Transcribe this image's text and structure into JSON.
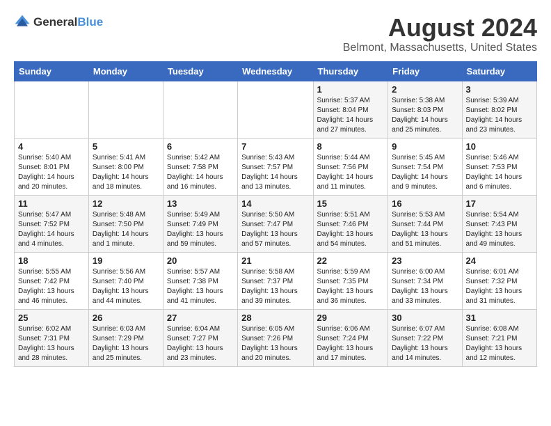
{
  "header": {
    "logo_general": "General",
    "logo_blue": "Blue",
    "month_year": "August 2024",
    "location": "Belmont, Massachusetts, United States"
  },
  "calendar": {
    "days_of_week": [
      "Sunday",
      "Monday",
      "Tuesday",
      "Wednesday",
      "Thursday",
      "Friday",
      "Saturday"
    ],
    "weeks": [
      [
        {
          "day": "",
          "info": ""
        },
        {
          "day": "",
          "info": ""
        },
        {
          "day": "",
          "info": ""
        },
        {
          "day": "",
          "info": ""
        },
        {
          "day": "1",
          "info": "Sunrise: 5:37 AM\nSunset: 8:04 PM\nDaylight: 14 hours\nand 27 minutes."
        },
        {
          "day": "2",
          "info": "Sunrise: 5:38 AM\nSunset: 8:03 PM\nDaylight: 14 hours\nand 25 minutes."
        },
        {
          "day": "3",
          "info": "Sunrise: 5:39 AM\nSunset: 8:02 PM\nDaylight: 14 hours\nand 23 minutes."
        }
      ],
      [
        {
          "day": "4",
          "info": "Sunrise: 5:40 AM\nSunset: 8:01 PM\nDaylight: 14 hours\nand 20 minutes."
        },
        {
          "day": "5",
          "info": "Sunrise: 5:41 AM\nSunset: 8:00 PM\nDaylight: 14 hours\nand 18 minutes."
        },
        {
          "day": "6",
          "info": "Sunrise: 5:42 AM\nSunset: 7:58 PM\nDaylight: 14 hours\nand 16 minutes."
        },
        {
          "day": "7",
          "info": "Sunrise: 5:43 AM\nSunset: 7:57 PM\nDaylight: 14 hours\nand 13 minutes."
        },
        {
          "day": "8",
          "info": "Sunrise: 5:44 AM\nSunset: 7:56 PM\nDaylight: 14 hours\nand 11 minutes."
        },
        {
          "day": "9",
          "info": "Sunrise: 5:45 AM\nSunset: 7:54 PM\nDaylight: 14 hours\nand 9 minutes."
        },
        {
          "day": "10",
          "info": "Sunrise: 5:46 AM\nSunset: 7:53 PM\nDaylight: 14 hours\nand 6 minutes."
        }
      ],
      [
        {
          "day": "11",
          "info": "Sunrise: 5:47 AM\nSunset: 7:52 PM\nDaylight: 14 hours\nand 4 minutes."
        },
        {
          "day": "12",
          "info": "Sunrise: 5:48 AM\nSunset: 7:50 PM\nDaylight: 14 hours\nand 1 minute."
        },
        {
          "day": "13",
          "info": "Sunrise: 5:49 AM\nSunset: 7:49 PM\nDaylight: 13 hours\nand 59 minutes."
        },
        {
          "day": "14",
          "info": "Sunrise: 5:50 AM\nSunset: 7:47 PM\nDaylight: 13 hours\nand 57 minutes."
        },
        {
          "day": "15",
          "info": "Sunrise: 5:51 AM\nSunset: 7:46 PM\nDaylight: 13 hours\nand 54 minutes."
        },
        {
          "day": "16",
          "info": "Sunrise: 5:53 AM\nSunset: 7:44 PM\nDaylight: 13 hours\nand 51 minutes."
        },
        {
          "day": "17",
          "info": "Sunrise: 5:54 AM\nSunset: 7:43 PM\nDaylight: 13 hours\nand 49 minutes."
        }
      ],
      [
        {
          "day": "18",
          "info": "Sunrise: 5:55 AM\nSunset: 7:42 PM\nDaylight: 13 hours\nand 46 minutes."
        },
        {
          "day": "19",
          "info": "Sunrise: 5:56 AM\nSunset: 7:40 PM\nDaylight: 13 hours\nand 44 minutes."
        },
        {
          "day": "20",
          "info": "Sunrise: 5:57 AM\nSunset: 7:38 PM\nDaylight: 13 hours\nand 41 minutes."
        },
        {
          "day": "21",
          "info": "Sunrise: 5:58 AM\nSunset: 7:37 PM\nDaylight: 13 hours\nand 39 minutes."
        },
        {
          "day": "22",
          "info": "Sunrise: 5:59 AM\nSunset: 7:35 PM\nDaylight: 13 hours\nand 36 minutes."
        },
        {
          "day": "23",
          "info": "Sunrise: 6:00 AM\nSunset: 7:34 PM\nDaylight: 13 hours\nand 33 minutes."
        },
        {
          "day": "24",
          "info": "Sunrise: 6:01 AM\nSunset: 7:32 PM\nDaylight: 13 hours\nand 31 minutes."
        }
      ],
      [
        {
          "day": "25",
          "info": "Sunrise: 6:02 AM\nSunset: 7:31 PM\nDaylight: 13 hours\nand 28 minutes."
        },
        {
          "day": "26",
          "info": "Sunrise: 6:03 AM\nSunset: 7:29 PM\nDaylight: 13 hours\nand 25 minutes."
        },
        {
          "day": "27",
          "info": "Sunrise: 6:04 AM\nSunset: 7:27 PM\nDaylight: 13 hours\nand 23 minutes."
        },
        {
          "day": "28",
          "info": "Sunrise: 6:05 AM\nSunset: 7:26 PM\nDaylight: 13 hours\nand 20 minutes."
        },
        {
          "day": "29",
          "info": "Sunrise: 6:06 AM\nSunset: 7:24 PM\nDaylight: 13 hours\nand 17 minutes."
        },
        {
          "day": "30",
          "info": "Sunrise: 6:07 AM\nSunset: 7:22 PM\nDaylight: 13 hours\nand 14 minutes."
        },
        {
          "day": "31",
          "info": "Sunrise: 6:08 AM\nSunset: 7:21 PM\nDaylight: 13 hours\nand 12 minutes."
        }
      ]
    ]
  }
}
